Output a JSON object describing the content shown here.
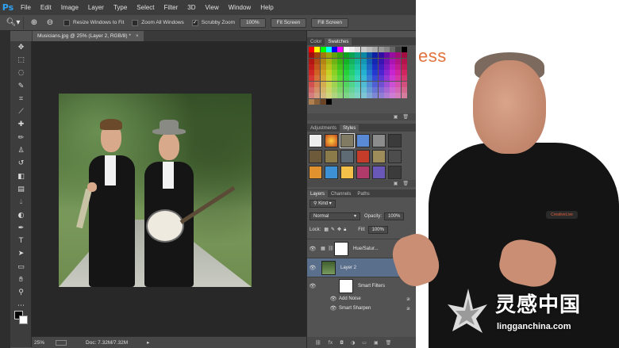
{
  "app": {
    "logo": "Ps"
  },
  "menu": [
    "File",
    "Edit",
    "Image",
    "Layer",
    "Type",
    "Select",
    "Filter",
    "3D",
    "View",
    "Window",
    "Help"
  ],
  "options": {
    "tool_icon": "zoom-tool-icon",
    "resize_windows_label": "Resize Windows to Fit",
    "resize_windows_checked": false,
    "zoom_all_label": "Zoom All Windows",
    "zoom_all_checked": false,
    "scrubby_label": "Scrubby Zoom",
    "scrubby_checked": true,
    "btn_100": "100%",
    "btn_fit": "Fit Screen",
    "btn_fill": "Fill Screen"
  },
  "document": {
    "tab_title": "Musicians.jpg @ 25% (Layer 2, RGB/8) *",
    "close": "×"
  },
  "status": {
    "zoom": "25%",
    "doc_info": "Doc: 7.32M/7.32M"
  },
  "swatch_panel": {
    "tabs": [
      "Color",
      "Swatches"
    ],
    "active": "Swatches"
  },
  "adjust_panel": {
    "tabs": [
      "Adjustments",
      "Styles"
    ],
    "active": "Styles"
  },
  "layers_panel": {
    "tabs": [
      "Layers",
      "Channels",
      "Paths"
    ],
    "active": "Layers",
    "filter_kind": "Kind",
    "blend_mode": "Normal",
    "opacity_label": "Opacity:",
    "opacity": "100%",
    "lock_label": "Lock:",
    "fill_label": "Fill:",
    "fill": "100%",
    "layers": [
      {
        "name": "Hue/Satur...",
        "type": "adjustment"
      },
      {
        "name": "Layer 2",
        "type": "smart-object",
        "selected": true
      },
      {
        "name": "Smart Filters",
        "type": "filter-group"
      },
      {
        "name": "Add Noise",
        "type": "filter"
      },
      {
        "name": "Smart Sharpen",
        "type": "filter"
      }
    ]
  },
  "video": {
    "heading_fragment": "ess",
    "badge": "CreativeLive"
  },
  "watermark": {
    "cn": "灵感中国",
    "url": "lingganchina.com"
  },
  "colors": {
    "accent_orange": "#e2733f",
    "ps_blue": "#2fa3f5",
    "selected_layer": "#5a6f8c"
  }
}
